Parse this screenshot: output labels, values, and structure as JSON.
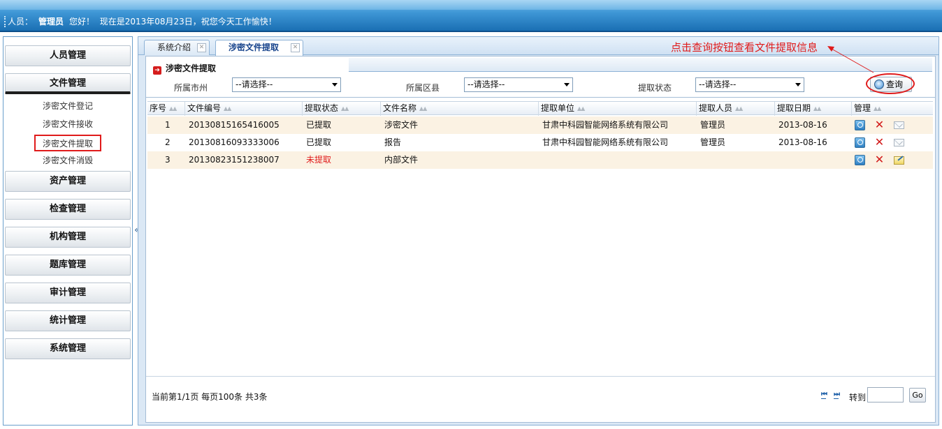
{
  "header": {
    "user_label": "人员：",
    "user_name": "管理员",
    "greeting": "您好！",
    "date_text": "现在是2013年08月23日，祝您今天工作愉快！"
  },
  "sidebar": {
    "groups": [
      {
        "label": "人员管理"
      },
      {
        "label": "文件管理"
      },
      {
        "label": "资产管理"
      },
      {
        "label": "检查管理"
      },
      {
        "label": "机构管理"
      },
      {
        "label": "题库管理"
      },
      {
        "label": "审计管理"
      },
      {
        "label": "统计管理"
      },
      {
        "label": "系统管理"
      }
    ],
    "file_items": [
      {
        "label": "涉密文件登记"
      },
      {
        "label": "涉密文件接收"
      },
      {
        "label": "涉密文件提取"
      },
      {
        "label": "涉密文件消毁"
      }
    ],
    "collapse_glyph": "«"
  },
  "tabs": [
    {
      "label": "系统介绍"
    },
    {
      "label": "涉密文件提取"
    }
  ],
  "hint_text": "点击查询按钮查看文件提取信息",
  "panel": {
    "title": "涉密文件提取",
    "filters": {
      "city_label": "所属市州",
      "city_value": "--请选择--",
      "county_label": "所属区县",
      "county_value": "--请选择--",
      "status_label": "提取状态",
      "status_value": "--请选择--"
    },
    "query_label": "查询"
  },
  "table": {
    "columns": [
      "序号",
      "文件编号",
      "提取状态",
      "文件名称",
      "提取单位",
      "提取人员",
      "提取日期",
      "管理"
    ],
    "rows": [
      {
        "no": "1",
        "file_id": "20130815165416005",
        "status": "已提取",
        "name": "涉密文件",
        "unit": "甘肃中科园智能网络系统有限公司",
        "person": "管理员",
        "date": "2013-08-16"
      },
      {
        "no": "2",
        "file_id": "20130816093333006",
        "status": "已提取",
        "name": "报告",
        "unit": "甘肃中科园智能网络系统有限公司",
        "person": "管理员",
        "date": "2013-08-16"
      },
      {
        "no": "3",
        "file_id": "20130823151238007",
        "status": "未提取",
        "name": "内部文件",
        "unit": "",
        "person": "",
        "date": ""
      }
    ]
  },
  "pager": {
    "info": "当前第1/1页  每页100条  共3条",
    "first": "⏮",
    "last": "⏭",
    "goto_label": "转到",
    "go_label": "Go"
  },
  "colors": {
    "header_blue": "#1a6fb3",
    "highlight_red": "#e01b1b",
    "row_alt": "#fbf2e3"
  }
}
